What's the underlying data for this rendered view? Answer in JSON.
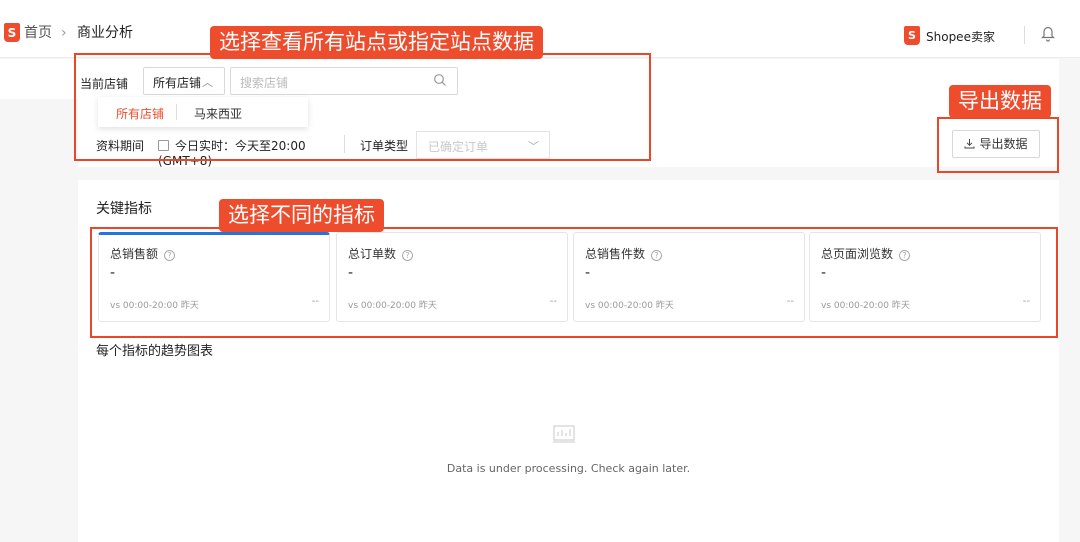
{
  "header": {
    "logo": "S",
    "breadcrumb": {
      "home": "首页",
      "separator": "›",
      "current": "商业分析"
    },
    "seller_logo": "S",
    "seller_label": "Shopee卖家"
  },
  "filters": {
    "store_label": "当前店铺",
    "store_value": "所有店铺",
    "store_search_placeholder": "搜索店铺",
    "dropdown_items": [
      "所有店铺",
      "马来西亚"
    ],
    "period_label": "资料期间",
    "period_value": "今日实时：今天至20:00 (GMT+8)",
    "order_type_label": "订单类型",
    "order_type_value": "已确定订单",
    "export_label": "导出数据"
  },
  "key_metrics": {
    "title": "关键指标",
    "cards": [
      {
        "name": "总销售额",
        "value": "-",
        "compare": "vs 00:00-20:00 昨天",
        "change": "--"
      },
      {
        "name": "总订单数",
        "value": "-",
        "compare": "vs 00:00-20:00 昨天",
        "change": "--"
      },
      {
        "name": "总销售件数",
        "value": "-",
        "compare": "vs 00:00-20:00 昨天",
        "change": "--"
      },
      {
        "name": "总页面浏览数",
        "value": "-",
        "compare": "vs 00:00-20:00 昨天",
        "change": "--"
      }
    ],
    "trend_title": "每个指标的趋势图表",
    "empty_message": "Data is under processing. Check again later."
  },
  "annotations": {
    "store_select": "选择查看所有站点或指定站点数据",
    "export": "导出数据",
    "metrics": "选择不同的指标"
  },
  "colors": {
    "brand": "#ee4d2d",
    "active": "#2673dd",
    "annotation": "#e8472a"
  }
}
